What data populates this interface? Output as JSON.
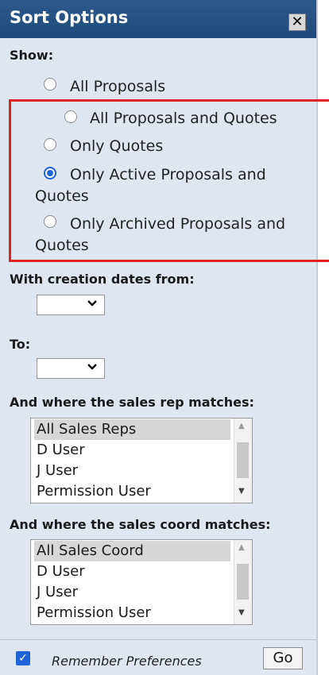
{
  "dialog": {
    "title": "Sort Options",
    "close_symbol": "✕"
  },
  "show": {
    "label": "Show:",
    "options": [
      {
        "line1": "All Proposals",
        "line2": "",
        "checked": false
      },
      {
        "line1": "All Proposals and Quotes",
        "line2": "",
        "checked": false
      },
      {
        "line1": "Only Quotes",
        "line2": "",
        "checked": false
      },
      {
        "line1": "Only Active Proposals and",
        "line2": "Quotes",
        "checked": true
      },
      {
        "line1": "Only Archived Proposals and",
        "line2": "Quotes",
        "checked": false
      }
    ]
  },
  "dates": {
    "from_label": "With creation dates from:",
    "from_value": "",
    "to_label": "To:",
    "to_value": ""
  },
  "sales_rep": {
    "label": "And where the sales rep matches:",
    "options": [
      "All Sales Reps",
      "D User",
      "J User",
      "Permission User"
    ],
    "selected_index": 0
  },
  "sales_coord": {
    "label": "And where the sales coord matches:",
    "options": [
      "All Sales Coord",
      "D User",
      "J User",
      "Permission User"
    ],
    "selected_index": 0
  },
  "footer": {
    "remember_label": "Remember Preferences",
    "remember_checked": true,
    "go_label": "Go"
  },
  "colors": {
    "title_bar": "#1f4a7a",
    "panel": "#dfe6f0",
    "highlight": "#e02424",
    "accent": "#1f63d8"
  }
}
